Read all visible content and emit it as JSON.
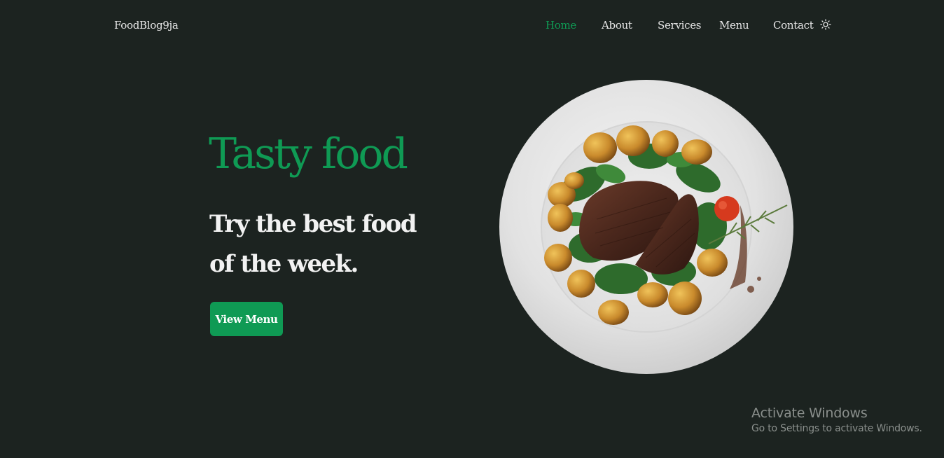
{
  "brand": {
    "logo": "FoodBlog9ja"
  },
  "nav": {
    "home": "Home",
    "about": "About",
    "services": "Services",
    "menu": "Menu",
    "contact": "Contact",
    "theme_icon": "sun-icon",
    "active": "Home"
  },
  "hero": {
    "title": "Tasty food",
    "subtitle_line1": "Try the best food",
    "subtitle_line2": "of the week.",
    "button": "View Menu",
    "image": "steak-plate-image"
  },
  "colors": {
    "background": "#1c2320",
    "accent": "#0f9a54",
    "text": "#e6e6e6"
  },
  "watermark": {
    "title": "Activate Windows",
    "subtitle": "Go to Settings to activate Windows."
  }
}
